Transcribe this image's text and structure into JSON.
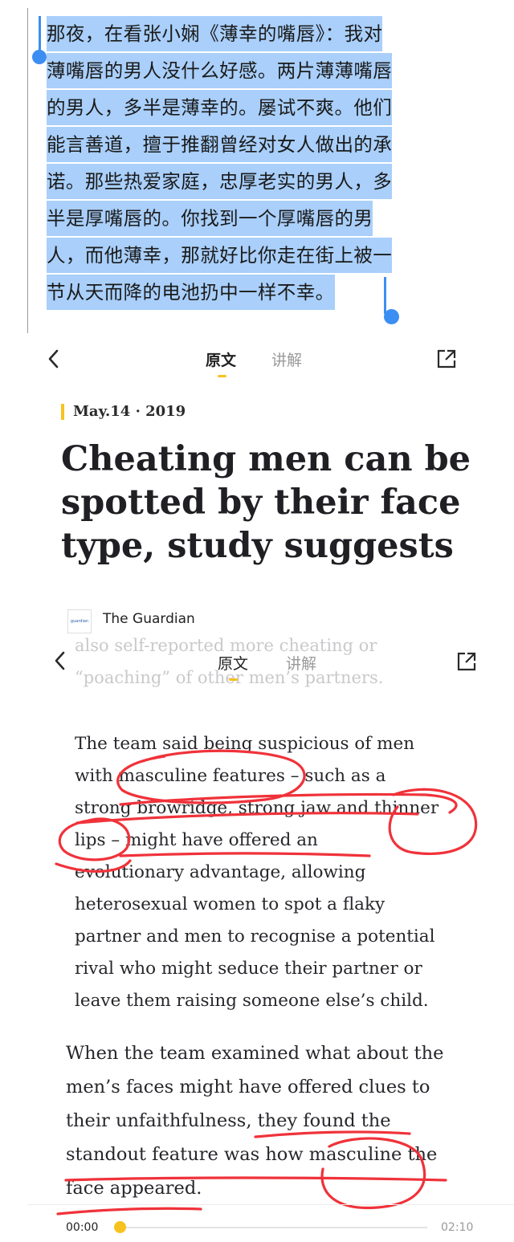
{
  "selection": {
    "lines": [
      "那夜，在看张小娴《薄幸的嘴唇》：我对",
      "薄嘴唇的男人没什么好感。两片薄薄嘴唇",
      "的男人，多半是薄幸的。屡试不爽。他们",
      "能言善道，擅于推翻曾经对女人做出的承",
      "诺。那些热爱家庭，忠厚老实的男人，多",
      "半是厚嘴唇的。你找到一个厚嘴唇的男",
      "人，而他薄幸，那就好比你走在街上被一",
      "节从天而降的电池扔中一样不幸。"
    ],
    "highlight_color": "#a9cffa",
    "handle_color": "#3d8ef2"
  },
  "nav": {
    "back_icon": "chevron-left-icon",
    "share_icon": "share-icon",
    "tabs": [
      "原文",
      "讲解"
    ],
    "active_tab": "原文"
  },
  "article": {
    "date": "May.14 · 2019",
    "headline": "Cheating men can be spotted by their face type, study suggests",
    "source_logo_text": "guardian",
    "source": "The Guardian",
    "faded_lines": [
      "also self-reported more cheating or",
      "“poaching” of other men’s partners."
    ],
    "paragraph1": [
      "The team said being suspicious of men",
      "with masculine features – such as a",
      "strong browridge, strong jaw and thinner",
      "lips – might have offered an",
      "evolutionary advantage, allowing",
      "heterosexual women to spot a flaky",
      "partner and men to recognise a potential",
      "rival who might seduce their partner or",
      "leave them raising someone else’s child."
    ],
    "paragraph2": [
      "When the team examined what about the",
      "men’s faces might have offered clues to",
      "their unfaithfulness, they found the",
      "standout feature was how masculine the",
      "face appeared."
    ]
  },
  "audio": {
    "current_time": "00:00",
    "total_time": "02:10",
    "progress": 0.0,
    "accent": "#f7c21e"
  },
  "ink_color": "#f0323a"
}
